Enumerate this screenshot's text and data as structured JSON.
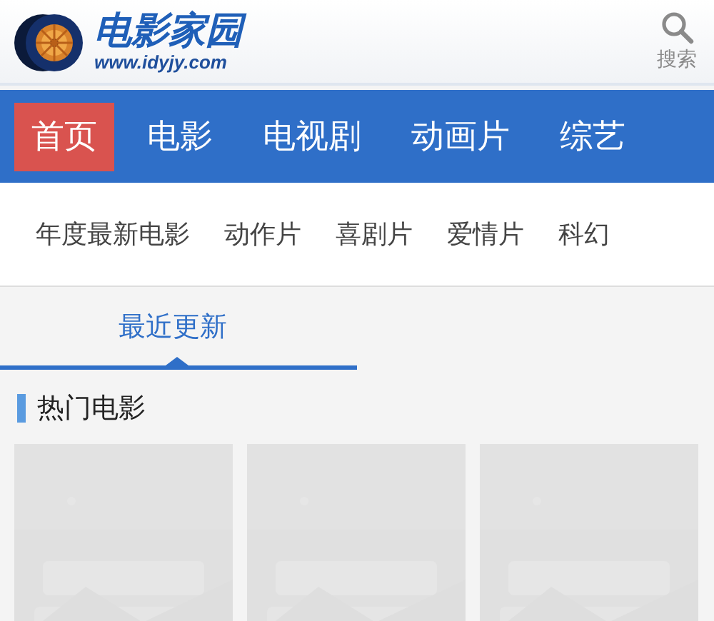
{
  "header": {
    "logo_title": "电影家园",
    "logo_url": "www.idyjy.com",
    "search_label": "搜索"
  },
  "nav": [
    {
      "label": "首页",
      "selected": true
    },
    {
      "label": "电影",
      "selected": false
    },
    {
      "label": "电视剧",
      "selected": false
    },
    {
      "label": "动画片",
      "selected": false
    },
    {
      "label": "综艺",
      "selected": false
    }
  ],
  "categories": [
    "年度最新电影",
    "动作片",
    "喜剧片",
    "爱情片",
    "科幻"
  ],
  "tabs": [
    {
      "label": "最近更新",
      "selected": true
    }
  ],
  "section": {
    "title": "热门电影"
  }
}
